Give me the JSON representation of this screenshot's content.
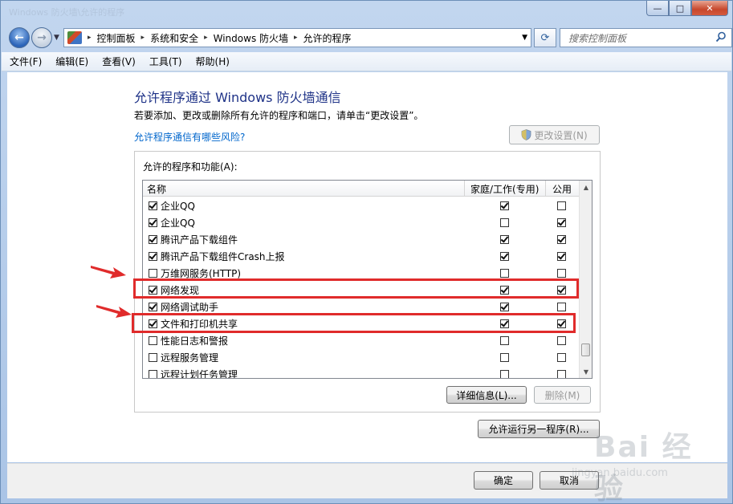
{
  "window": {
    "ghost_title": "Windows 防火墙\\允许的程序"
  },
  "caption": {
    "minimize": "▭",
    "maximize": "□",
    "close": "✕"
  },
  "address": {
    "crumbs": [
      "控制面板",
      "系统和安全",
      "Windows 防火墙",
      "允许的程序"
    ],
    "separator": "▸",
    "search_placeholder": "搜索控制面板"
  },
  "menu": [
    "文件(F)",
    "编辑(E)",
    "查看(V)",
    "工具(T)",
    "帮助(H)"
  ],
  "page": {
    "title": "允许程序通过 Windows 防火墙通信",
    "description": "若要添加、更改或删除所有允许的程序和端口，请单击“更改设置”。",
    "risk_link": "允许程序通信有哪些风险?",
    "change_settings": "更改设置(N)"
  },
  "programs": {
    "group_label": "允许的程序和功能(A):",
    "columns": {
      "name": "名称",
      "home": "家庭/工作(专用)",
      "public": "公用"
    },
    "rows": [
      {
        "name": "企业QQ",
        "enabled": true,
        "home": true,
        "public": false
      },
      {
        "name": "企业QQ",
        "enabled": true,
        "home": false,
        "public": true
      },
      {
        "name": "腾讯产品下载组件",
        "enabled": true,
        "home": true,
        "public": true
      },
      {
        "name": "腾讯产品下载组件Crash上报",
        "enabled": true,
        "home": true,
        "public": true
      },
      {
        "name": "万维网服务(HTTP)",
        "enabled": false,
        "home": false,
        "public": false
      },
      {
        "name": "网络发现",
        "enabled": true,
        "home": true,
        "public": true
      },
      {
        "name": "网络调试助手",
        "enabled": true,
        "home": true,
        "public": false
      },
      {
        "name": "文件和打印机共享",
        "enabled": true,
        "home": true,
        "public": true
      },
      {
        "name": "性能日志和警报",
        "enabled": false,
        "home": false,
        "public": false
      },
      {
        "name": "远程服务管理",
        "enabled": false,
        "home": false,
        "public": false
      },
      {
        "name": "远程计划任务管理",
        "enabled": false,
        "home": false,
        "public": false
      }
    ],
    "details_button": "详细信息(L)...",
    "remove_button": "删除(M)"
  },
  "allow_another": "允许运行另一程序(R)...",
  "footer": {
    "ok": "确定",
    "cancel": "取消"
  },
  "watermark": {
    "text": "Bai 经验",
    "sub": "jingyan.baidu.com"
  },
  "colors": {
    "highlight": "#e02b2b",
    "title": "#1e3287",
    "link": "#0066cc"
  }
}
